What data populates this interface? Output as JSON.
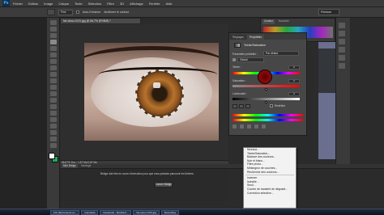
{
  "menubar": {
    "logo": "Ps",
    "items": [
      "Fichier",
      "Edition",
      "Image",
      "Calque",
      "Texte",
      "Sélection",
      "Filtre",
      "3D",
      "Affichage",
      "Fenêtre",
      "Aide"
    ]
  },
  "options": {
    "mode": "Fixe",
    "refine_label": "Améliorer le contour",
    "auto_label": "Auto-Enhance",
    "workspace": "Peinture"
  },
  "document": {
    "tab_title": "Ne-vieux-XXX.jpg @ 66,7% (RVB/8) *",
    "status": "66,67%   Doc : 1,87 Mo/1,87 Mo"
  },
  "bridge": {
    "tabs": [
      "Mini Bridge",
      "Montage"
    ],
    "message": "Bridge doit être en cours d'exécution pour que vous puissiez parcourir les fichiers.",
    "button": "Lancer Bridge"
  },
  "right_dock": {
    "tabs": [
      "Couleur",
      "Nuancier"
    ]
  },
  "hs_panel": {
    "tabs": [
      "Réglages",
      "Propriétés"
    ],
    "title": "Teinte/Saturation",
    "preset_label": "Paramètre prédéfini :",
    "preset_value": "Par défaut",
    "channel": "Global",
    "hue": {
      "label": "Teinte :",
      "value": "0"
    },
    "saturation": {
      "label": "Saturation :",
      "value": "0"
    },
    "lightness": {
      "label": "Luminosité :",
      "value": "0"
    },
    "colorize_label": "Redéfinir"
  },
  "context_menu": {
    "items": [
      "Niveaux...",
      "Teinte/Saturation...",
      "Balance des couleurs...",
      "Noir et blanc...",
      "Filtre photo...",
      "Mélangeur de couches...",
      "Recherche des couleurs...",
      "Inverser",
      "Isohélie...",
      "Seuil...",
      "Courbe de transfert de dégradé...",
      "Correction sélective..."
    ]
  },
  "taskbar": {
    "items": [
      "FIC [Documents et...",
      "Camtasia",
      "Facebook - Mozilla F...",
      "Ne-vieux-XXX.jpg",
      "Recording"
    ]
  }
}
